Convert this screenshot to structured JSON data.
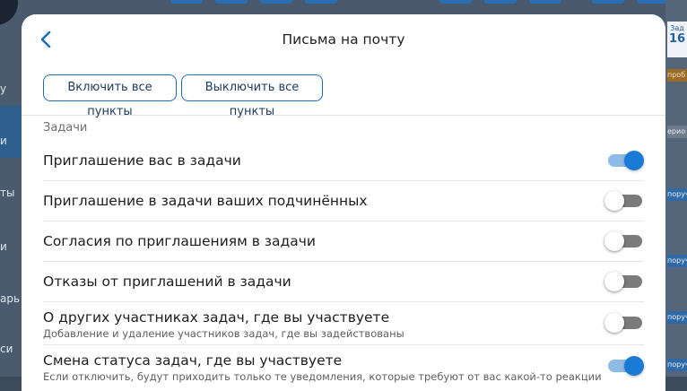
{
  "modal": {
    "title": "Письма на почту",
    "enable_all_label": "Включить все пункты",
    "disable_all_label": "Выключить все пункты"
  },
  "section": {
    "title": "Задачи"
  },
  "settings": [
    {
      "label": "Приглашение вас в задачи",
      "description": "",
      "enabled": true
    },
    {
      "label": "Приглашение в задачи ваших подчинённых",
      "description": "",
      "enabled": false
    },
    {
      "label": "Согласия по приглашениям в задачи",
      "description": "",
      "enabled": false
    },
    {
      "label": "Отказы от приглашений в задачи",
      "description": "",
      "enabled": false
    },
    {
      "label": "О других участниках задач, где вы участвуете",
      "description": "Добавление и удаление участников задач, где вы задействованы",
      "enabled": false
    },
    {
      "label": "Смена статуса задач, где вы участвуете",
      "description": "Если отключить, будут приходить только те уведомления, которые требуют от вас какой-то реакции",
      "enabled": true
    }
  ],
  "background": {
    "left_fragments": [
      "у",
      "и",
      "ты",
      "и",
      "арь",
      "си"
    ],
    "calendar_day_label": "Зад",
    "calendar_day": "16",
    "right_tags": [
      "проб",
      "ерио",
      "поруч",
      "поруч",
      "поруч",
      "поруч"
    ]
  },
  "colors": {
    "accent": "#1a7bd6",
    "toggle_off": "#7b7b7b",
    "toggle_on_track": "#8cbbe6",
    "orange_tag": "#9a6a26"
  }
}
